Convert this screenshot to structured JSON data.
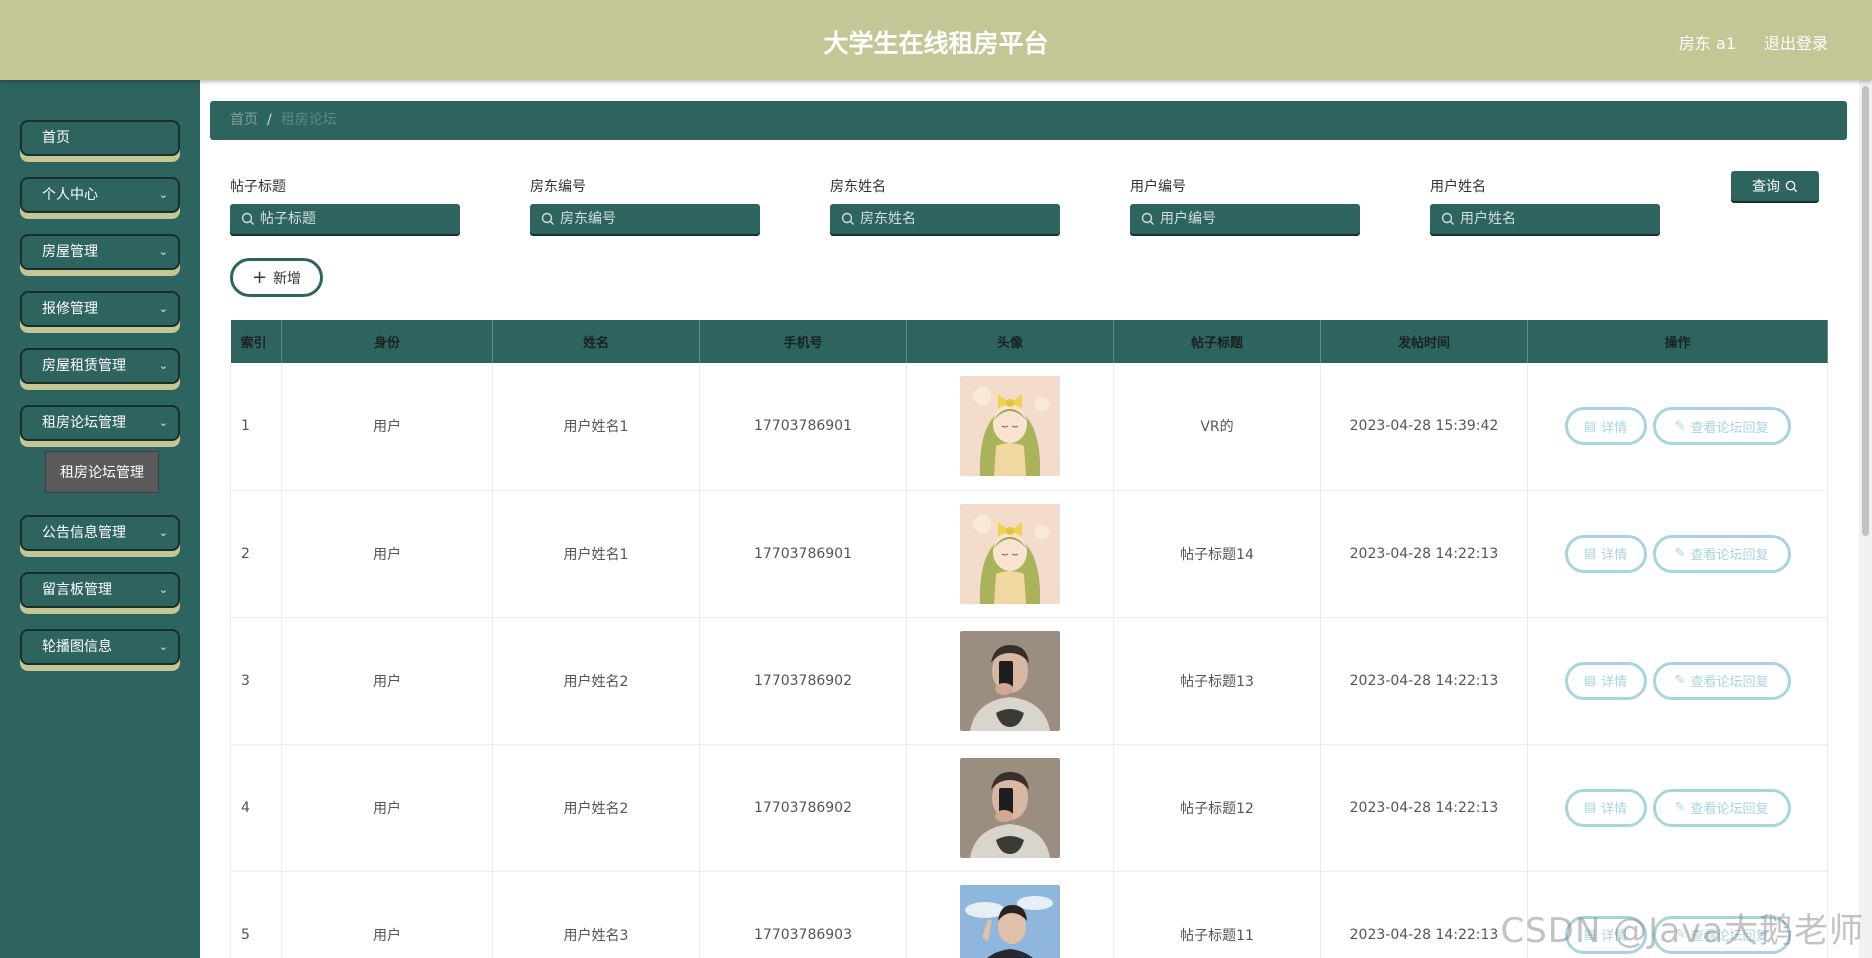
{
  "header": {
    "title": "大学生在线租房平台",
    "user": "房东 a1",
    "logout": "退出登录"
  },
  "sidebar": {
    "items": [
      {
        "label": "首页",
        "has_children": false
      },
      {
        "label": "个人中心",
        "has_children": true
      },
      {
        "label": "房屋管理",
        "has_children": true
      },
      {
        "label": "报修管理",
        "has_children": true
      },
      {
        "label": "房屋租赁管理",
        "has_children": true
      },
      {
        "label": "租房论坛管理",
        "has_children": true
      },
      {
        "label": "公告信息管理",
        "has_children": true
      },
      {
        "label": "留言板管理",
        "has_children": true
      },
      {
        "label": "轮播图信息",
        "has_children": true
      }
    ],
    "submenu": {
      "label": "租房论坛管理"
    }
  },
  "breadcrumb": {
    "home": "首页",
    "separator": "/",
    "current": "租房论坛"
  },
  "filters": [
    {
      "label": "帖子标题",
      "placeholder": "帖子标题"
    },
    {
      "label": "房东编号",
      "placeholder": "房东编号"
    },
    {
      "label": "房东姓名",
      "placeholder": "房东姓名"
    },
    {
      "label": "用户编号",
      "placeholder": "用户编号"
    },
    {
      "label": "用户姓名",
      "placeholder": "用户姓名"
    }
  ],
  "query_button": "查询",
  "add_button": "新增",
  "table": {
    "columns": [
      "索引",
      "身份",
      "姓名",
      "手机号",
      "头像",
      "帖子标题",
      "发帖时间",
      "操作"
    ],
    "rows": [
      {
        "index": "1",
        "role": "用户",
        "name": "用户姓名1",
        "phone": "17703786901",
        "avatar": "anime-girl",
        "title": "VR的",
        "time": "2023-04-28 15:39:42"
      },
      {
        "index": "2",
        "role": "用户",
        "name": "用户姓名1",
        "phone": "17703786901",
        "avatar": "anime-girl",
        "title": "帖子标题14",
        "time": "2023-04-28 14:22:13"
      },
      {
        "index": "3",
        "role": "用户",
        "name": "用户姓名2",
        "phone": "17703786902",
        "avatar": "selfie-man",
        "title": "帖子标题13",
        "time": "2023-04-28 14:22:13"
      },
      {
        "index": "4",
        "role": "用户",
        "name": "用户姓名2",
        "phone": "17703786902",
        "avatar": "selfie-man",
        "title": "帖子标题12",
        "time": "2023-04-28 14:22:13"
      },
      {
        "index": "5",
        "role": "用户",
        "name": "用户姓名3",
        "phone": "17703786903",
        "avatar": "outdoor-man",
        "title": "帖子标题11",
        "time": "2023-04-28 14:22:13"
      }
    ],
    "actions": {
      "detail": "详情",
      "reply": "查看论坛回复"
    }
  },
  "watermark": "CSDN @Java大鹅老师",
  "colors": {
    "header": "#c4c696",
    "primary": "#2e6460",
    "action_outline": "#a8d4e0"
  }
}
